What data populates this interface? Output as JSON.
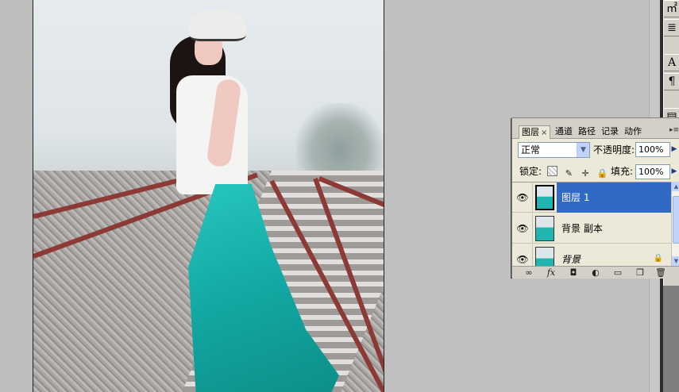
{
  "canvas": {
    "image_subject": "girl-on-railway-track"
  },
  "layers_panel": {
    "tabs": [
      {
        "label": "图层",
        "active": true
      },
      {
        "label": "通道",
        "active": false
      },
      {
        "label": "路径",
        "active": false
      },
      {
        "label": "记录",
        "active": false
      },
      {
        "label": "动作",
        "active": false
      }
    ],
    "tab_close_glyph": "×",
    "blend_mode": "正常",
    "opacity_label": "不透明度:",
    "opacity_value": "100%",
    "lock_label": "锁定:",
    "fill_label": "填充:",
    "fill_value": "100%",
    "layers": [
      {
        "name": "图层 1",
        "visible": true,
        "selected": true,
        "locked": false
      },
      {
        "name": "背景 副本",
        "visible": true,
        "selected": false,
        "locked": false
      },
      {
        "name": "背景",
        "visible": true,
        "selected": false,
        "locked": true
      }
    ],
    "footer_icons": [
      "link-icon",
      "fx-icon",
      "mask-icon",
      "adjustment-icon",
      "folder-icon",
      "new-layer-icon",
      "trash-icon"
    ]
  },
  "tool_palette": {
    "buttons": [
      "character-tool",
      "paragraph-tool",
      "type-tool",
      "paragraph-mark",
      "misc-tool"
    ]
  },
  "colors": {
    "selection": "#316ac5",
    "panel_bg": "#ece9d8",
    "workspace": "#c0c0c0",
    "skirt": "#15aaa5"
  }
}
